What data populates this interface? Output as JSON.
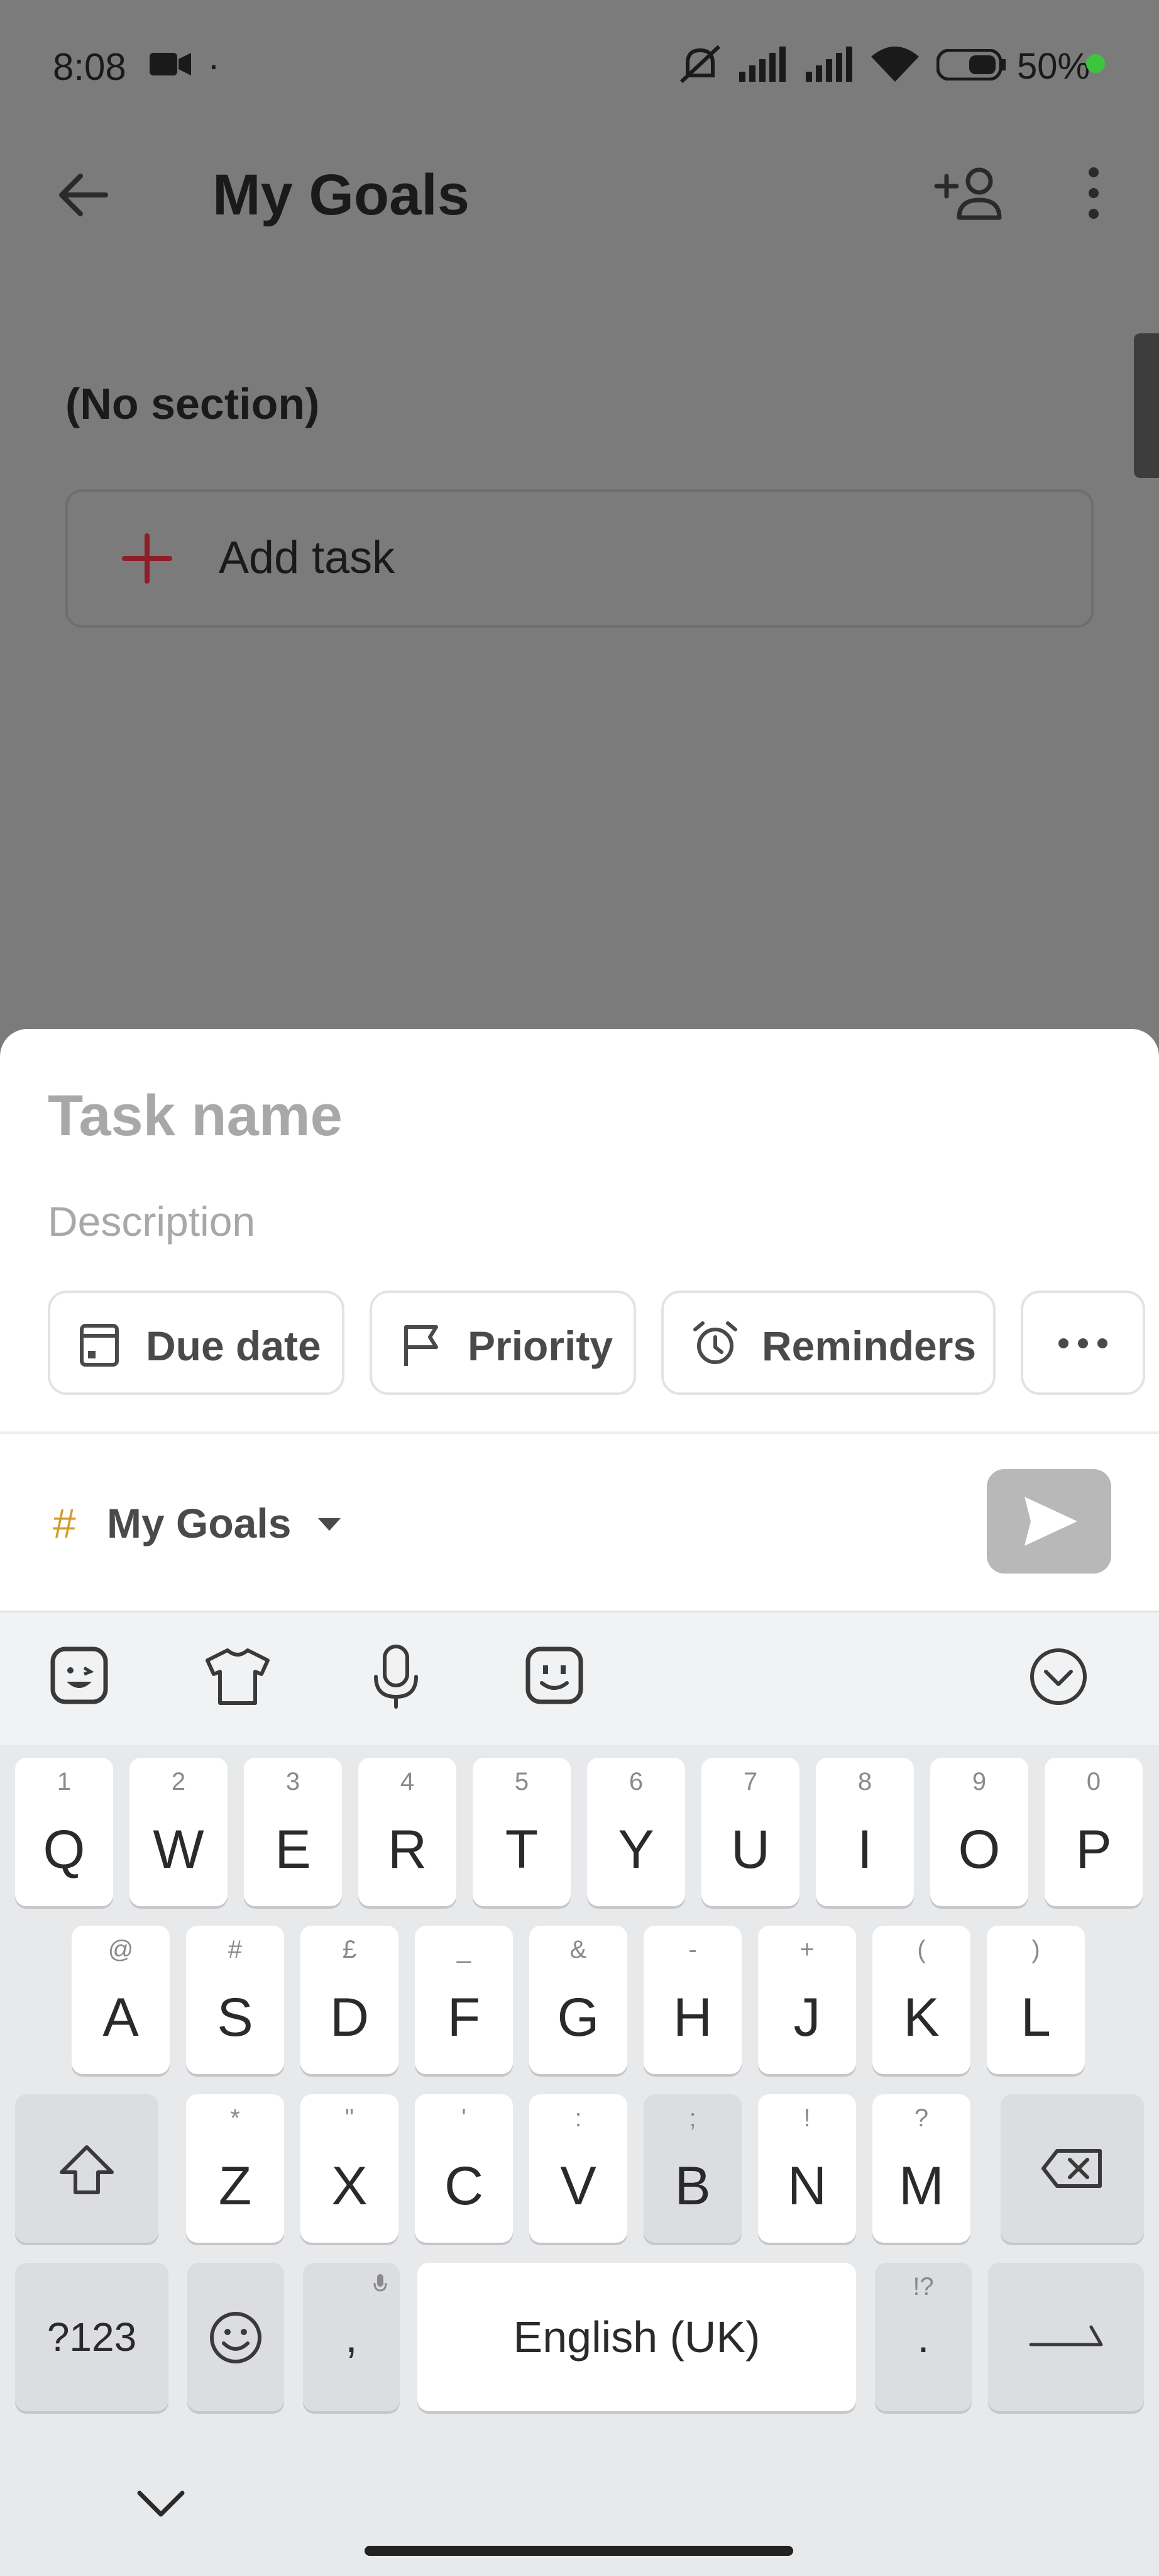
{
  "status_bar": {
    "time": "8:08",
    "dot": "·",
    "battery_text": "50%",
    "icons": [
      "video-camera-icon",
      "mute-icon",
      "signal-icon",
      "signal-icon",
      "wifi-icon",
      "battery-icon",
      "charging-dot-icon"
    ]
  },
  "app_bar": {
    "back_icon": "arrow-left-icon",
    "title": "My Goals",
    "share_icon": "add-person-icon",
    "more_icon": "more-vertical-icon"
  },
  "section": {
    "title": "(No section)",
    "add_task_label": "Add task",
    "add_icon": "plus-icon"
  },
  "quick_add": {
    "task_name_placeholder": "Task name",
    "description_placeholder": "Description",
    "chips": [
      {
        "label": "Due date",
        "icon": "calendar-icon"
      },
      {
        "label": "Priority",
        "icon": "flag-icon"
      },
      {
        "label": "Reminders",
        "icon": "alarm-icon"
      },
      {
        "label": "···",
        "icon": "more-horizontal-icon"
      }
    ],
    "project_hash": "#",
    "project_name": "My Goals",
    "send_icon": "send-icon"
  },
  "keyboard": {
    "toolbar_icons": [
      "sticker-icon",
      "theme-shirt-icon",
      "microphone-icon",
      "emoji-face-icon",
      "collapse-keyboard-icon"
    ],
    "row1": [
      {
        "k": "Q",
        "h": "1"
      },
      {
        "k": "W",
        "h": "2"
      },
      {
        "k": "E",
        "h": "3"
      },
      {
        "k": "R",
        "h": "4"
      },
      {
        "k": "T",
        "h": "5"
      },
      {
        "k": "Y",
        "h": "6"
      },
      {
        "k": "U",
        "h": "7"
      },
      {
        "k": "I",
        "h": "8"
      },
      {
        "k": "O",
        "h": "9"
      },
      {
        "k": "P",
        "h": "0"
      }
    ],
    "row2": [
      {
        "k": "A",
        "h": "@"
      },
      {
        "k": "S",
        "h": "#"
      },
      {
        "k": "D",
        "h": "£"
      },
      {
        "k": "F",
        "h": "_"
      },
      {
        "k": "G",
        "h": "&"
      },
      {
        "k": "H",
        "h": "-"
      },
      {
        "k": "J",
        "h": "+"
      },
      {
        "k": "K",
        "h": "("
      },
      {
        "k": "L",
        "h": ")"
      }
    ],
    "row3": [
      {
        "k": "Z",
        "h": "*"
      },
      {
        "k": "X",
        "h": "\""
      },
      {
        "k": "C",
        "h": "'"
      },
      {
        "k": "V",
        "h": ":"
      },
      {
        "k": "B",
        "h": ";"
      },
      {
        "k": "N",
        "h": "!"
      },
      {
        "k": "M",
        "h": "?"
      }
    ],
    "symbols_label": "?123",
    "comma_label": ",",
    "space_label": "English (UK)",
    "period_label": ".",
    "period_hint": "!?",
    "nav_down_icon": "chevron-down-icon"
  }
}
